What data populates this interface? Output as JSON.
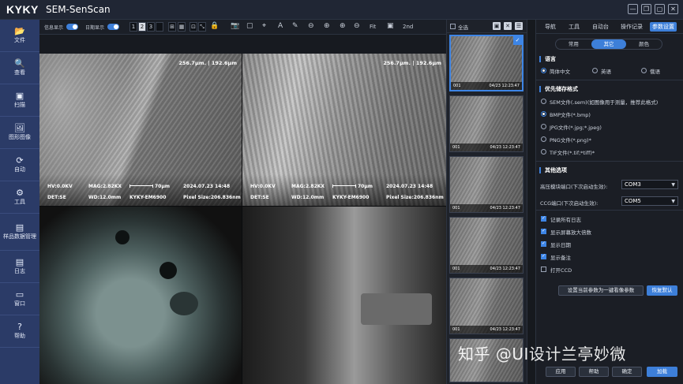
{
  "window": {
    "logo": "KYKY",
    "title": "SEM-SenScan",
    "controls": [
      "—",
      "❐",
      "▢",
      "✕"
    ]
  },
  "nav": [
    {
      "icon": "📂",
      "label": "文件"
    },
    {
      "icon": "🔍",
      "label": "查看"
    },
    {
      "icon": "▣",
      "label": "扫描"
    },
    {
      "icon": "🖼",
      "label": "图形图像"
    },
    {
      "icon": "⟳",
      "label": "自动"
    },
    {
      "icon": "⚙",
      "label": "工具"
    },
    {
      "icon": "▤",
      "label": "样品数据管理"
    },
    {
      "icon": "▤",
      "label": "日志"
    },
    {
      "icon": "▭",
      "label": "窗口"
    },
    {
      "icon": "?",
      "label": "帮助"
    }
  ],
  "toolbar": {
    "info_label": "信息显示",
    "date_label": "日期显示",
    "layouts": [
      "1",
      "2",
      "3",
      ""
    ],
    "tool_icons": [
      "📷",
      "▢",
      "⌖",
      "A",
      "✎",
      "⊖",
      "⊕",
      "⊕",
      "⊖",
      "▣"
    ],
    "fit_label": "Fit",
    "second_label": "2nd"
  },
  "sem_panels": [
    {
      "scale": "256.7μm. | 192.6μm",
      "hv": "HV:0.0KV",
      "mag": "MAG:2.82KX",
      "scalebar": "70μm",
      "date": "2024.07.23  14:48",
      "det": "DET:SE",
      "wd": "WD:12.0mm",
      "model": "KYKY-EM6900",
      "pixel": "Pixel Size:206.836nm"
    },
    {
      "scale": "256.7μm. | 192.6μm",
      "hv": "HV:0.0KV",
      "mag": "MAG:2.82KX",
      "scalebar": "70μm",
      "date": "2024.07.23  14:48",
      "det": "DET:SE",
      "wd": "WD:12.0mm",
      "model": "KYKY-EM6900",
      "pixel": "Pixel Size:206.836nm"
    }
  ],
  "thumbnails": {
    "select_all": "全选",
    "items": [
      {
        "index": "001",
        "time": "04/23 12:23:47"
      },
      {
        "index": "001",
        "time": "04/23 12:23:47"
      },
      {
        "index": "001",
        "time": "04/23 12:23:47"
      },
      {
        "index": "001",
        "time": "04/23 12:23:47"
      },
      {
        "index": "001",
        "time": "04/23 12:23:47"
      }
    ]
  },
  "right_panel": {
    "tabs": [
      "导航",
      "工具",
      "自动台",
      "操作记录",
      "参数设置"
    ],
    "segments": [
      "常用",
      "其它",
      "颜色"
    ],
    "language_title": "语言",
    "languages": [
      "简体中文",
      "英语",
      "俄语"
    ],
    "format_title": "优先储存格式",
    "formats": [
      "SEM文件(.sem)(如图像用于测量，推荐此格式)",
      "BMP文件(*.bmp)",
      "JPG文件(*.jpg;*.jpeg)",
      "PNG文件(*.png)*",
      "TIF文件(*.tif;*tiff)*"
    ],
    "other_title": "其他选项",
    "hv_port_label": "高压模块端口(下次启动生效):",
    "hv_port_value": "COM3",
    "ccg_port_label": "CCG端口(下次启动生效):",
    "ccg_port_value": "COM5",
    "checks": [
      "记录所有日志",
      "显示屏幕放大倍数",
      "显示日期",
      "显示备注",
      "打开CCD"
    ],
    "set_default_btn": "设置当前参数为一键看像参数",
    "restore_btn": "恢复默认",
    "apply_btn": "应用",
    "help_btn": "帮助",
    "ok_btn": "确定",
    "load_btn": "加载"
  },
  "watermark": "知乎 @UI设计兰亭妙微",
  "accent": "#3d7fd9"
}
